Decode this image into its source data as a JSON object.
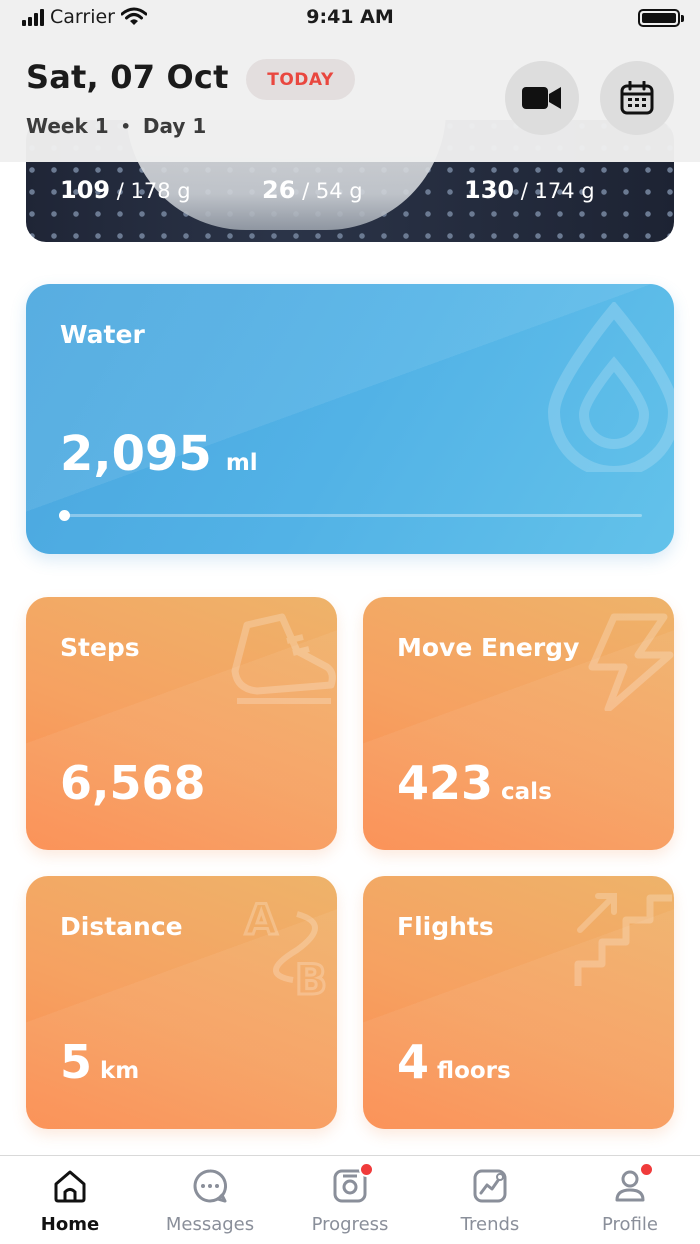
{
  "status_bar": {
    "carrier": "Carrier",
    "time": "9:41 AM"
  },
  "header": {
    "date": "Sat, 07 Oct",
    "today_badge": "TODAY",
    "week": "Week 1",
    "separator": "•",
    "day": "Day 1",
    "buttons": [
      "video-camera-icon",
      "calendar-icon"
    ]
  },
  "food_card": {
    "macros": [
      {
        "value": "109",
        "total": " / 178 g"
      },
      {
        "value": "26",
        "total": " / 54 g"
      },
      {
        "value": "130",
        "total": " / 174 g"
      }
    ]
  },
  "water": {
    "title": "Water",
    "value": "2,095",
    "unit": "ml",
    "progress": 0.0
  },
  "cards": {
    "steps": {
      "title": "Steps",
      "value": "6,568",
      "unit": "",
      "icon": "sneaker-icon"
    },
    "move_energy": {
      "title": "Move Energy",
      "value": "423",
      "unit": "cals",
      "icon": "lightning-icon"
    },
    "distance": {
      "title": "Distance",
      "value": "5",
      "unit": "km",
      "icon": "a-to-b-icon"
    },
    "flights": {
      "title": "Flights",
      "value": "4",
      "unit": "floors",
      "icon": "stairs-icon"
    }
  },
  "tabs": [
    {
      "label": "Home",
      "active": true,
      "badge": false
    },
    {
      "label": "Messages",
      "active": false,
      "badge": false
    },
    {
      "label": "Progress",
      "active": false,
      "badge": true
    },
    {
      "label": "Trends",
      "active": false,
      "badge": false
    },
    {
      "label": "Profile",
      "active": false,
      "badge": true
    }
  ],
  "colors": {
    "water_card": "#52b2e6",
    "orange_card": "#f6a161",
    "badge_red": "#f03b3b",
    "today_text": "#e9473f"
  }
}
